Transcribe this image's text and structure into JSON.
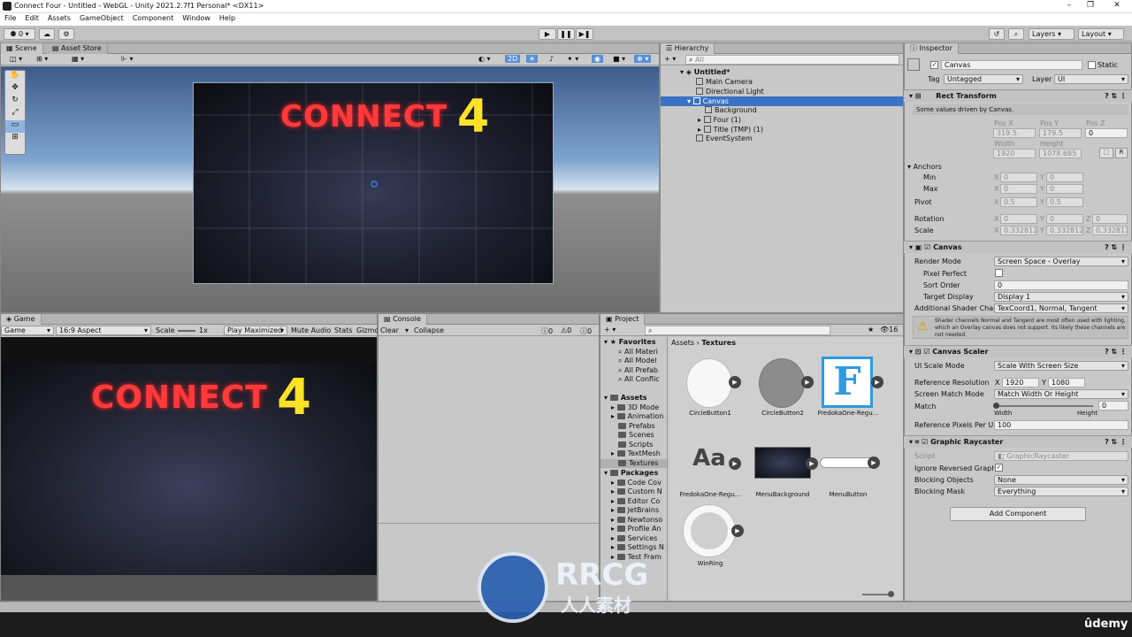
{
  "window": {
    "title": "Connect Four - Untitled - WebGL - Unity 2021.2.7f1 Personal* <DX11>"
  },
  "menu": [
    "File",
    "Edit",
    "Assets",
    "GameObject",
    "Component",
    "Window",
    "Help"
  ],
  "toolbar": {
    "account_label": "0",
    "layers_label": "Layers",
    "layout_label": "Layout"
  },
  "scene": {
    "tab_scene": "Scene",
    "tab_store": "Asset Store",
    "title_text": "CONNECT",
    "title_digit": "4"
  },
  "game": {
    "tab": "Game",
    "display": "Game",
    "aspect": "16:9 Aspect",
    "scale_label": "Scale",
    "scale_value": "1x",
    "play_maximized": "Play Maximized",
    "mute_audio": "Mute Audio",
    "stats": "Stats",
    "gizmos": "Gizmo",
    "title_text": "CONNECT",
    "title_digit": "4"
  },
  "console": {
    "tab": "Console",
    "clear": "Clear",
    "collapse": "Collapse",
    "count_log": "0",
    "count_warn": "0",
    "count_err": "0"
  },
  "hierarchy": {
    "tab": "Hierarchy",
    "search_placeholder": "All",
    "items": [
      {
        "label": "Untitled*"
      },
      {
        "label": "Main Camera"
      },
      {
        "label": "Directional Light"
      },
      {
        "label": "Canvas"
      },
      {
        "label": "Background"
      },
      {
        "label": "Four (1)"
      },
      {
        "label": "Title (TMP) (1)"
      },
      {
        "label": "EventSystem"
      }
    ]
  },
  "project": {
    "tab": "Project",
    "count": "16",
    "favorites_label": "Favorites",
    "favorites": [
      "All Materi",
      "All Model",
      "All Prefab",
      "All Conflic"
    ],
    "assets_label": "Assets",
    "asset_folders": [
      "3D Mode",
      "Animation",
      "Prefabs",
      "Scenes",
      "Scripts",
      "TextMesh",
      "Textures"
    ],
    "packages_label": "Packages",
    "package_folders": [
      "Code Cov",
      "Custom N",
      "Editor Co",
      "JetBrains",
      "Newtonso",
      "Profile An",
      "Services",
      "Settings N",
      "Test Fram"
    ],
    "breadcrumb_root": "Assets",
    "breadcrumb_current": "Textures",
    "files": [
      "CircleButton1",
      "CircleButton2",
      "FredokaOne-Regu...",
      "FredokaOne-Regu...",
      "MenuBackground",
      "MenuButton",
      "WinRing"
    ],
    "font_glyph_big": "F",
    "font_glyph_aa": "Aa"
  },
  "inspector": {
    "tab": "Inspector",
    "object_name": "Canvas",
    "static_label": "Static",
    "tag_label": "Tag",
    "tag_value": "Untagged",
    "layer_label": "Layer",
    "layer_value": "UI",
    "rect": {
      "header": "Rect Transform",
      "note": "Some values driven by Canvas.",
      "posx_label": "Pos X",
      "posy_label": "Pos Y",
      "posz_label": "Pos Z",
      "posx": "319.5",
      "posy": "179.5",
      "posz": "0",
      "width_label": "Width",
      "height_label": "Height",
      "width": "1920",
      "height": "1078.685",
      "anchors_label": "Anchors",
      "min_label": "Min",
      "max_label": "Max",
      "min_x": "0",
      "min_y": "0",
      "max_x": "0",
      "max_y": "0",
      "pivot_label": "Pivot",
      "pivot_x": "0.5",
      "pivot_y": "0.5",
      "rotation_label": "Rotation",
      "rot_x": "0",
      "rot_y": "0",
      "rot_z": "0",
      "scale_label": "Scale",
      "scale_x": "0.332812",
      "scale_y": "0.332812",
      "scale_z": "0.332812",
      "x": "X",
      "y": "Y",
      "z": "Z",
      "r": "R"
    },
    "canvas": {
      "header": "Canvas",
      "render_mode_label": "Render Mode",
      "render_mode": "Screen Space - Overlay",
      "pixel_perfect_label": "Pixel Perfect",
      "sort_order_label": "Sort Order",
      "sort_order": "0",
      "target_display_label": "Target Display",
      "target_display": "Display 1",
      "shader_channels_label": "Additional Shader Chann",
      "shader_channels": "TexCoord1, Normal, Tangent",
      "warning": "Shader channels Normal and Tangent are most often used with lighting, which an Overlay canvas does not support. Its likely these channels are not needed."
    },
    "scaler": {
      "header": "Canvas Scaler",
      "ui_scale_mode_label": "UI Scale Mode",
      "ui_scale_mode": "Scale With Screen Size",
      "ref_res_label": "Reference Resolution",
      "ref_x": "1920",
      "ref_y": "1080",
      "match_mode_label": "Screen Match Mode",
      "match_mode": "Match Width Or Height",
      "match_label": "Match",
      "match_value": "0",
      "match_fraction": 0,
      "width_label": "Width",
      "height_label": "Height",
      "ref_ppu_label": "Reference Pixels Per Un",
      "ref_ppu": "100"
    },
    "raycaster": {
      "header": "Graphic Raycaster",
      "script_label": "Script",
      "script_value": "GraphicRaycaster",
      "ignore_label": "Ignore Reversed Graphic",
      "blocking_objects_label": "Blocking Objects",
      "blocking_objects": "None",
      "blocking_mask_label": "Blocking Mask",
      "blocking_mask": "Everything"
    },
    "add_component": "Add Component"
  },
  "watermark": {
    "brand": "RRCG",
    "sub": "人人素材"
  },
  "footer": {
    "brand": "ûdemy"
  }
}
